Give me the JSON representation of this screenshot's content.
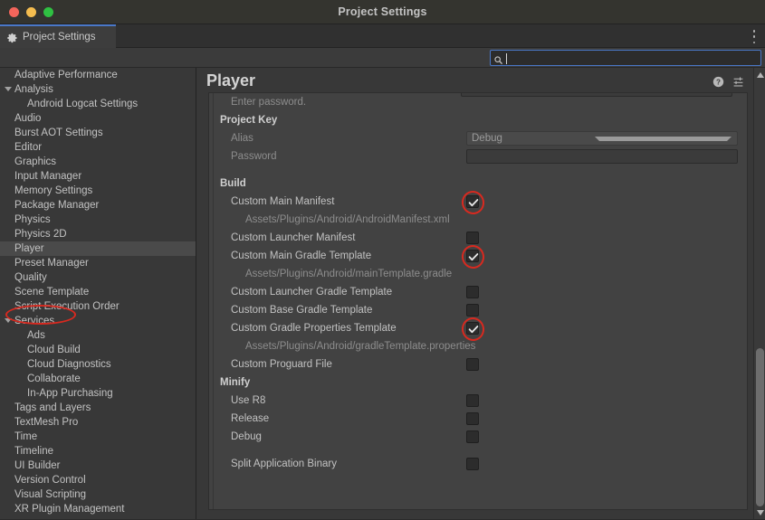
{
  "window": {
    "title": "Project Settings",
    "traffic_lights": [
      "close-red",
      "minimize-yellow",
      "maximize-green"
    ]
  },
  "tab": {
    "label": "Project Settings",
    "icon": "gear-icon",
    "overflow_icon": "kebab-menu-icon"
  },
  "search": {
    "value": "",
    "placeholder": "",
    "icon": "search-icon"
  },
  "sidebar": {
    "items": [
      {
        "label": "Adaptive Performance",
        "indent": 0,
        "arrow": false,
        "selected": false
      },
      {
        "label": "Analysis",
        "indent": 0,
        "arrow": true,
        "selected": false
      },
      {
        "label": "Android Logcat Settings",
        "indent": 1,
        "arrow": false,
        "selected": false
      },
      {
        "label": "Audio",
        "indent": 0,
        "arrow": false,
        "selected": false
      },
      {
        "label": "Burst AOT Settings",
        "indent": 0,
        "arrow": false,
        "selected": false
      },
      {
        "label": "Editor",
        "indent": 0,
        "arrow": false,
        "selected": false
      },
      {
        "label": "Graphics",
        "indent": 0,
        "arrow": false,
        "selected": false
      },
      {
        "label": "Input Manager",
        "indent": 0,
        "arrow": false,
        "selected": false
      },
      {
        "label": "Memory Settings",
        "indent": 0,
        "arrow": false,
        "selected": false
      },
      {
        "label": "Package Manager",
        "indent": 0,
        "arrow": false,
        "selected": false
      },
      {
        "label": "Physics",
        "indent": 0,
        "arrow": false,
        "selected": false
      },
      {
        "label": "Physics 2D",
        "indent": 0,
        "arrow": false,
        "selected": false
      },
      {
        "label": "Player",
        "indent": 0,
        "arrow": false,
        "selected": true
      },
      {
        "label": "Preset Manager",
        "indent": 0,
        "arrow": false,
        "selected": false
      },
      {
        "label": "Quality",
        "indent": 0,
        "arrow": false,
        "selected": false
      },
      {
        "label": "Scene Template",
        "indent": 0,
        "arrow": false,
        "selected": false
      },
      {
        "label": "Script Execution Order",
        "indent": 0,
        "arrow": false,
        "selected": false
      },
      {
        "label": "Services",
        "indent": 0,
        "arrow": true,
        "selected": false
      },
      {
        "label": "Ads",
        "indent": 1,
        "arrow": false,
        "selected": false
      },
      {
        "label": "Cloud Build",
        "indent": 1,
        "arrow": false,
        "selected": false
      },
      {
        "label": "Cloud Diagnostics",
        "indent": 1,
        "arrow": false,
        "selected": false
      },
      {
        "label": "Collaborate",
        "indent": 1,
        "arrow": false,
        "selected": false
      },
      {
        "label": "In-App Purchasing",
        "indent": 1,
        "arrow": false,
        "selected": false
      },
      {
        "label": "Tags and Layers",
        "indent": 0,
        "arrow": false,
        "selected": false
      },
      {
        "label": "TextMesh Pro",
        "indent": 0,
        "arrow": false,
        "selected": false
      },
      {
        "label": "Time",
        "indent": 0,
        "arrow": false,
        "selected": false
      },
      {
        "label": "Timeline",
        "indent": 0,
        "arrow": false,
        "selected": false
      },
      {
        "label": "UI Builder",
        "indent": 0,
        "arrow": false,
        "selected": false
      },
      {
        "label": "Version Control",
        "indent": 0,
        "arrow": false,
        "selected": false
      },
      {
        "label": "Visual Scripting",
        "indent": 0,
        "arrow": false,
        "selected": false
      },
      {
        "label": "XR Plugin Management",
        "indent": 0,
        "arrow": false,
        "selected": false
      }
    ]
  },
  "panel": {
    "title": "Player",
    "icons": [
      "help-icon",
      "preset-icon",
      "kebab-menu-icon"
    ],
    "rows": [
      {
        "kind": "text",
        "label": "Enter password.",
        "indent": 1,
        "style": "dim"
      },
      {
        "kind": "header",
        "label": "Project Key",
        "indent": 0
      },
      {
        "kind": "dropdown",
        "label": "Alias",
        "indent": 1,
        "style": "dim",
        "value": "Debug"
      },
      {
        "kind": "field",
        "label": "Password",
        "indent": 1,
        "style": "dim"
      },
      {
        "kind": "spacer"
      },
      {
        "kind": "header",
        "label": "Build",
        "indent": 0
      },
      {
        "kind": "checkbox",
        "label": "Custom Main Manifest",
        "indent": 1,
        "checked": true,
        "annotated": true
      },
      {
        "kind": "text",
        "label": "Assets/Plugins/Android/AndroidManifest.xml",
        "indent": 2,
        "style": "dim"
      },
      {
        "kind": "checkbox",
        "label": "Custom Launcher Manifest",
        "indent": 1,
        "checked": false,
        "annotated": false
      },
      {
        "kind": "checkbox",
        "label": "Custom Main Gradle Template",
        "indent": 1,
        "checked": true,
        "annotated": true
      },
      {
        "kind": "text",
        "label": "Assets/Plugins/Android/mainTemplate.gradle",
        "indent": 2,
        "style": "dim"
      },
      {
        "kind": "checkbox",
        "label": "Custom Launcher Gradle Template",
        "indent": 1,
        "checked": false,
        "annotated": false
      },
      {
        "kind": "checkbox",
        "label": "Custom Base Gradle Template",
        "indent": 1,
        "checked": false,
        "annotated": false
      },
      {
        "kind": "checkbox",
        "label": "Custom Gradle Properties Template",
        "indent": 1,
        "checked": true,
        "annotated": true
      },
      {
        "kind": "text",
        "label": "Assets/Plugins/Android/gradleTemplate.properties",
        "indent": 2,
        "style": "dim"
      },
      {
        "kind": "checkbox",
        "label": "Custom Proguard File",
        "indent": 1,
        "checked": false,
        "annotated": false
      },
      {
        "kind": "header",
        "label": "Minify",
        "indent": 0
      },
      {
        "kind": "checkbox",
        "label": "Use R8",
        "indent": 1,
        "checked": false,
        "annotated": false
      },
      {
        "kind": "checkbox",
        "label": "Release",
        "indent": 1,
        "checked": false,
        "annotated": false
      },
      {
        "kind": "checkbox",
        "label": "Debug",
        "indent": 1,
        "checked": false,
        "annotated": false
      },
      {
        "kind": "spacer"
      },
      {
        "kind": "checkbox",
        "label": "Split Application Binary",
        "indent": 1,
        "checked": false,
        "annotated": false
      }
    ]
  },
  "scrollbar": {
    "orientation": "vertical",
    "up_arrow": "triangle-up-icon",
    "down_arrow": "triangle-down-icon"
  },
  "colors": {
    "accent": "#4a78c8",
    "annotation": "#d8291f",
    "panel_bg": "#383838",
    "inspector_bg": "#424242"
  }
}
